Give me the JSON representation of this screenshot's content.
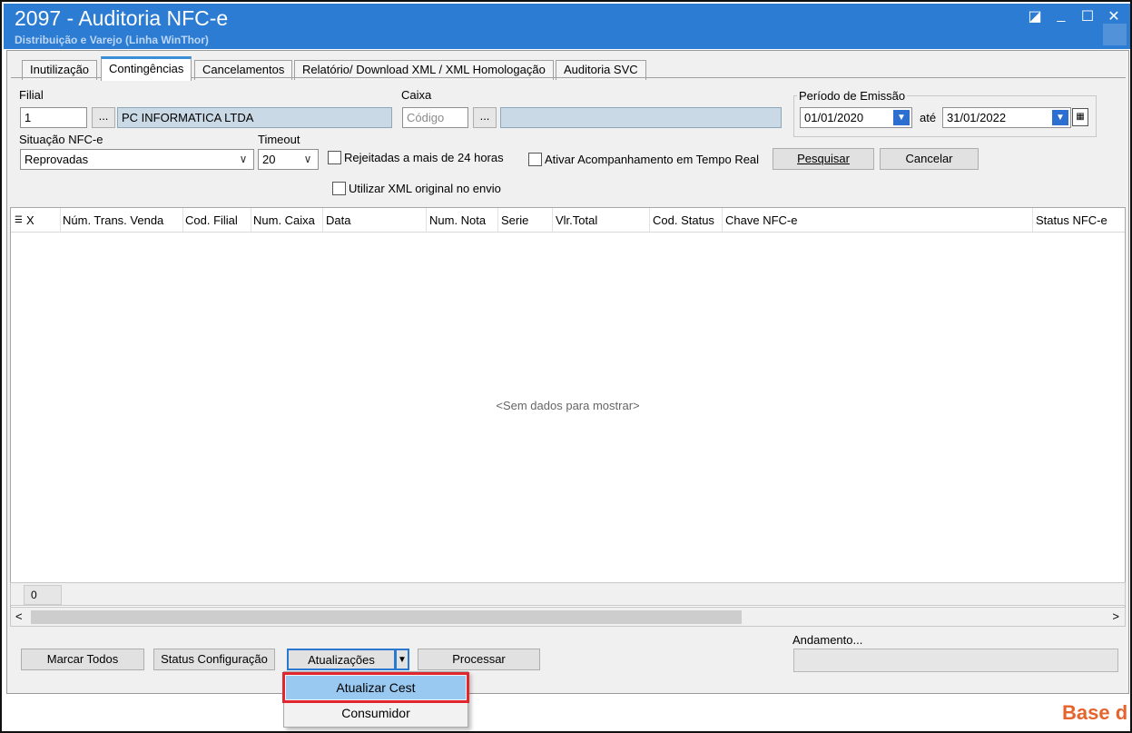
{
  "window": {
    "title": "2097 - Auditoria NFC-e",
    "subtitle": "Distribuição e Varejo (Linha WinThor)"
  },
  "tabs": [
    {
      "label": "Inutilização"
    },
    {
      "label": "Contingências",
      "active": true
    },
    {
      "label": "Cancelamentos"
    },
    {
      "label": "Relatório/ Download XML / XML Homologação"
    },
    {
      "label": "Auditoria SVC"
    }
  ],
  "filters": {
    "filial_label": "Filial",
    "filial_value": "1",
    "filial_name": "PC INFORMATICA LTDA",
    "browse_label": "...",
    "caixa_label": "Caixa",
    "caixa_placeholder": "Código",
    "caixa_name": "",
    "periodo_label": "Período de Emissão",
    "date_from": "01/01/2020",
    "date_sep": "até",
    "date_to": "31/01/2022",
    "situacao_label": "Situação NFC-e",
    "situacao_value": "Reprovadas",
    "timeout_label": "Timeout",
    "timeout_value": "20",
    "rejeitadas_label": "Rejeitadas a mais de 24 horas",
    "rejeitadas_checked": false,
    "acompanhamento_label": "Ativar Acompanhamento em Tempo Real",
    "acompanhamento_checked": false,
    "xml_original_label": "Utilizar XML original no envio",
    "xml_original_checked": false,
    "pesquisar_label": "Pesquisar",
    "cancelar_label": "Cancelar"
  },
  "grid": {
    "columns": [
      "X",
      "Núm. Trans. Venda",
      "Cod. Filial",
      "Num. Caixa",
      "Data",
      "Num. Nota",
      "Serie",
      "Vlr.Total",
      "Cod. Status",
      "Chave NFC-e",
      "Status NFC-e"
    ],
    "empty_text": "<Sem dados para mostrar>",
    "footer_count": "0"
  },
  "actions": {
    "marcar_todos": "Marcar Todos",
    "status_config": "Status Configuração",
    "atualizacoes": "Atualizações",
    "processar": "Processar",
    "andamento_label": "Andamento...",
    "andamento_progress": 0
  },
  "dropdown_menu": {
    "items": [
      {
        "label": "Atualizar Cest",
        "highlighted": true
      },
      {
        "label": "Consumidor"
      }
    ]
  },
  "brand": "Base d",
  "colors": {
    "titlebar": "#2b7cd2",
    "highlight_border": "#e0262e",
    "menu_highlight": "#99c9f0"
  }
}
